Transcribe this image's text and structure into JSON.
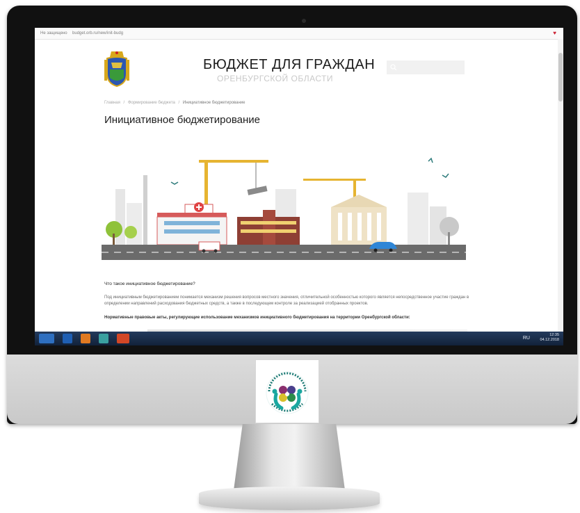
{
  "browser": {
    "secure_label": "Не защищено",
    "url": "budget.orb.ru/new/init-budg",
    "extension_icon": "heart-icon"
  },
  "site": {
    "title": "БЮДЖЕТ ДЛЯ ГРАЖДАН",
    "subtitle": "ОРЕНБУРГСКОЙ ОБЛАСТИ",
    "search_icon": "search-icon"
  },
  "breadcrumb": {
    "items": [
      "Главная",
      "/",
      "Формирование бюджета",
      "/",
      "Инициативное бюджетирование"
    ]
  },
  "page": {
    "heading": "Инициативное бюджетирование",
    "question": "Что такое инициативное бюджетирование?",
    "paragraph": "Под инициативным бюджетированием понимается механизм решения вопросов местного значения, отличительной особенностью которого является непосредственное участие граждан в определении направлений расходования бюджетных средств, а также в последующем контроле за реализацией отобранных проектов.",
    "acts_heading": "Нормативные правовые акты, регулирующие использование механизмов инициативного бюджетирования на территории Оренбургской области:"
  },
  "taskbar": {
    "language": "RU",
    "time": "12:35",
    "date": "04.12.2018"
  },
  "colors": {
    "accent_red": "#e04343",
    "taskbar": "#1b2d49",
    "logo_teal": "#1aa7a0"
  }
}
